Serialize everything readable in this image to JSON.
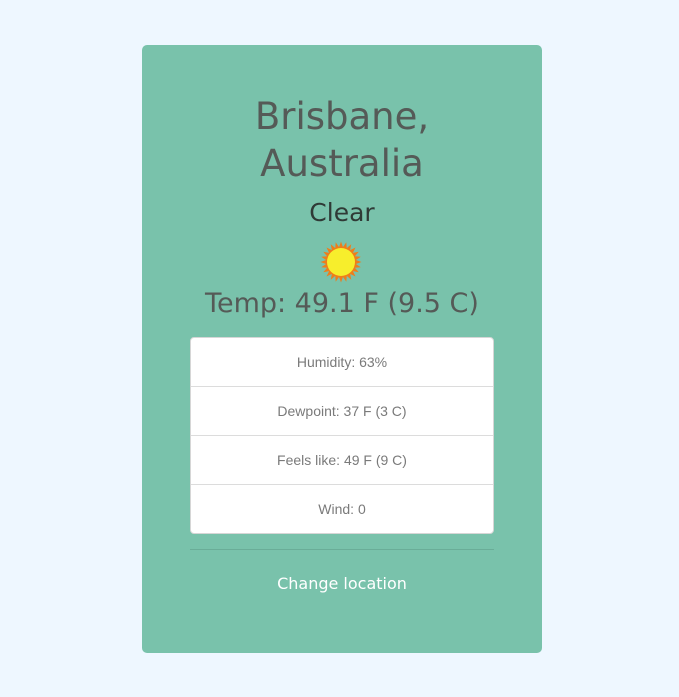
{
  "weather": {
    "location_line1": "Brisbane,",
    "location_line2": "Australia",
    "condition": "Clear",
    "condition_icon": "sun-icon",
    "temperature": "Temp: 49.1 F (9.5 C)"
  },
  "details": [
    {
      "label": "Humidity: 63%"
    },
    {
      "label": "Dewpoint: 37 F (3 C)"
    },
    {
      "label": "Feels like: 49 F (9 C)"
    },
    {
      "label": "Wind: 0"
    }
  ],
  "actions": {
    "change_location": "Change location"
  },
  "colors": {
    "page_background": "#eef7ff",
    "card_background": "#79c2ab",
    "heading_text": "#555a57",
    "link_text": "#ffffff",
    "sun_fill": "#f7ee2c",
    "sun_ray": "#ef7d1a"
  }
}
